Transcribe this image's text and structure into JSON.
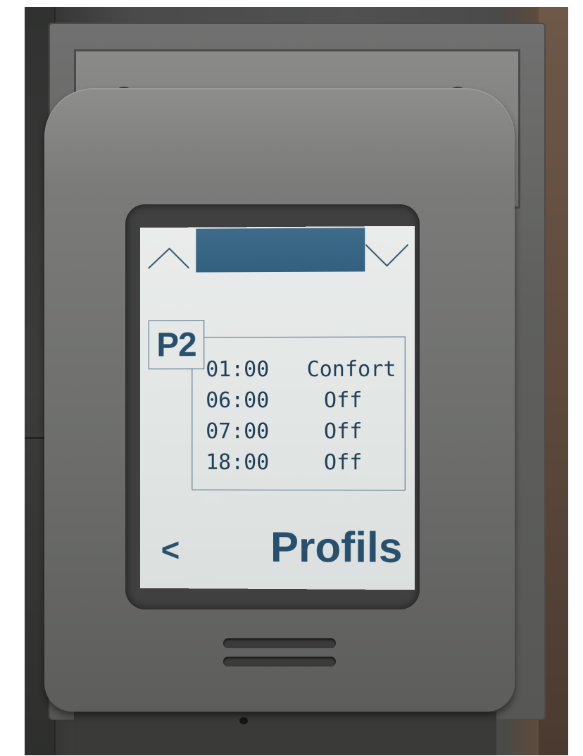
{
  "screen": {
    "profile": "P2",
    "schedule": [
      {
        "time": "01:00",
        "mode": "Confort"
      },
      {
        "time": "06:00",
        "mode": "Off"
      },
      {
        "time": "07:00",
        "mode": "Off"
      },
      {
        "time": "18:00",
        "mode": "Off"
      }
    ],
    "back_label": "<",
    "title": "Profils"
  },
  "icons": {
    "up": "chevron-up-icon",
    "down": "chevron-down-icon"
  },
  "colors": {
    "lcd_background": "#e4e8e6",
    "lcd_text": "#27506e",
    "title_bar": "#3a6585",
    "device_body": "#7b7c7a"
  }
}
